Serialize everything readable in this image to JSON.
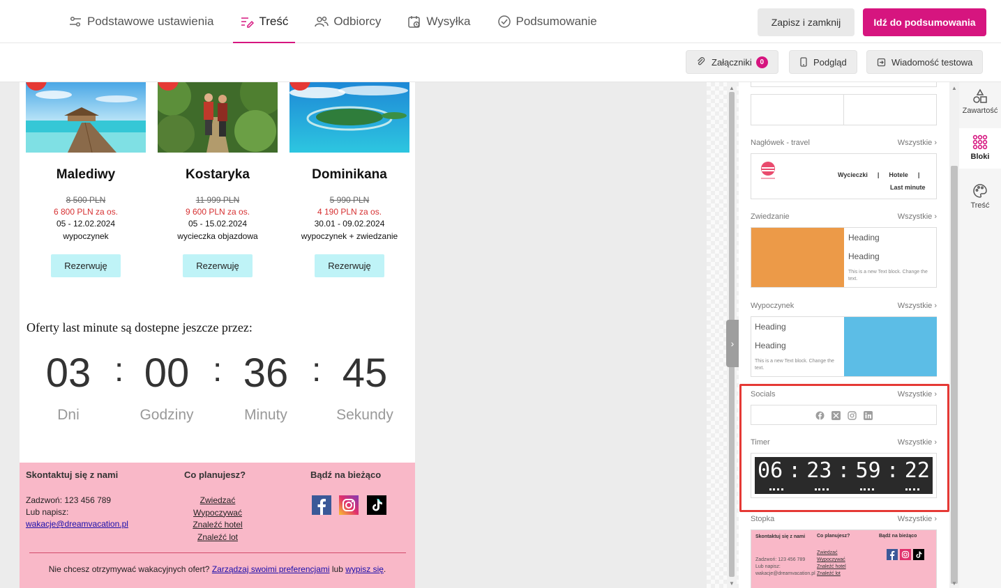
{
  "nav": {
    "tabs": [
      {
        "label": "Podstawowe ustawienia",
        "icon": "settings-sliders-icon",
        "active": false
      },
      {
        "label": "Treść",
        "icon": "content-edit-icon",
        "active": true
      },
      {
        "label": "Odbiorcy",
        "icon": "users-icon",
        "active": false
      },
      {
        "label": "Wysyłka",
        "icon": "calendar-icon",
        "active": false
      },
      {
        "label": "Podsumowanie",
        "icon": "check-circle-icon",
        "active": false
      }
    ],
    "save_label": "Zapisz i zamknij",
    "next_label": "Idź do podsumowania"
  },
  "toolbar": {
    "attachments_label": "Załączniki",
    "attachments_count": "0",
    "preview_label": "Podgląd",
    "test_label": "Wiadomość testowa"
  },
  "email": {
    "offers": [
      {
        "name": "Malediwy",
        "old_price": "8 500 PLN",
        "new_price": "6 800 PLN za os.",
        "dates": "05 - 12.02.2024",
        "type": "wypoczynek",
        "button": "Rezerwuję"
      },
      {
        "name": "Kostaryka",
        "old_price": "11 999 PLN",
        "new_price": "9 600 PLN za os.",
        "dates": "05 - 15.02.2024",
        "type": "wycieczka objazdowa",
        "button": "Rezerwuję"
      },
      {
        "name": "Dominikana",
        "old_price": "5 990 PLN",
        "new_price": "4 190 PLN za os.",
        "dates": "30.01 - 09.02.2024",
        "type": "wypoczynek + zwiedzanie",
        "button": "Rezerwuję"
      }
    ],
    "lastminute_text": "Oferty last minute są dostepne jeszcze przez:",
    "countdown": {
      "values": [
        "03",
        "00",
        "36",
        "45"
      ],
      "labels": [
        "Dni",
        "Godziny",
        "Minuty",
        "Sekundy"
      ],
      "separator": ":"
    },
    "footer": {
      "contact_title": "Skontaktuj się z nami",
      "phone": "Zadzwoń: 123 456 789",
      "write": "Lub napisz:",
      "email": "wakacje@dreamvacation.pl",
      "plan_title": "Co planujesz?",
      "plan_links": [
        "Zwiedzać",
        "Wypoczywać",
        "Znaleźć hotel",
        "Znaleźć lot"
      ],
      "social_title": "Bądź na bieżąco",
      "unsub_prefix": "Nie chcesz otrzymywać wakacyjnych ofert? ",
      "unsub_manage": "Zarządzaj swoimi preferencjami",
      "unsub_or": " lub ",
      "unsub_out": "wypisz się",
      "unsub_suffix": "."
    }
  },
  "panel": {
    "all_label": "Wszystkie",
    "blocks": {
      "header_travel": {
        "title": "Nagłówek - travel",
        "nav": [
          "Wycieczki",
          "|",
          "Hotele",
          "|"
        ],
        "nav2": "Last minute"
      },
      "sightseeing": {
        "title": "Zwiedzanie",
        "heading1": "Heading",
        "heading2": "Heading",
        "text": "This is a new Text block. Change the text."
      },
      "leisure": {
        "title": "Wypoczynek",
        "heading1": "Heading",
        "heading2": "Heading",
        "text": "This is a new Text block. Change the text."
      },
      "socials": {
        "title": "Socials"
      },
      "timer": {
        "title": "Timer",
        "values": [
          "06",
          "23",
          "59",
          "22"
        ],
        "separator": ":"
      },
      "footer": {
        "title": "Stopka",
        "contact_title": "Skontaktuj się z nami",
        "contact_text": "Zadzwoń: 123 456 789 Lub napisz: wakacje@dreamvacation.pl",
        "plan_title": "Co planujesz?",
        "plan_links": [
          "Zwiedzać",
          "Wypoczywać",
          "Znaleźć hotel",
          "Znaleźć lot"
        ],
        "social_title": "Bądź na bieżąco"
      }
    }
  },
  "side_tabs": [
    {
      "label": "Zawartość",
      "icon": "shapes-icon",
      "active": false
    },
    {
      "label": "Bloki",
      "icon": "grid-dots-icon",
      "active": true
    },
    {
      "label": "Treść",
      "icon": "palette-icon",
      "active": false
    }
  ],
  "colors": {
    "accent": "#d6157f",
    "footer_bg": "#f9b8c8",
    "button_bg": "#bff3f7",
    "price_red": "#d63031",
    "highlight": "#e53935"
  }
}
